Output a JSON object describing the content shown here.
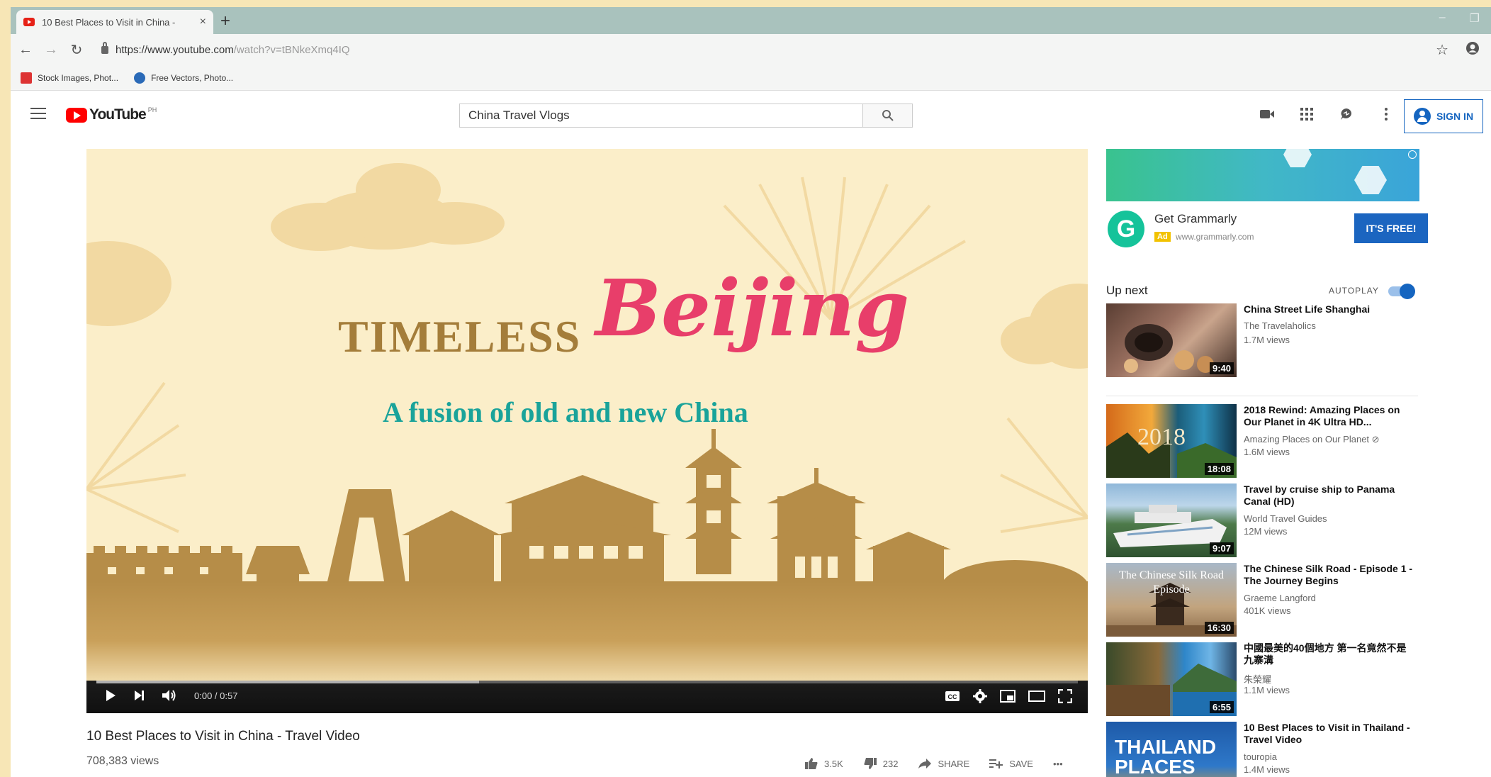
{
  "browser": {
    "tab_title": "10 Best Places to Visit in China -",
    "tab_close": "×",
    "new_tab": "+",
    "url_base": "https://www.youtube.com",
    "url_rest": "/watch?v=tBNkeXmq4IQ",
    "bookmarks": [
      "Stock Images, Phot...",
      "Free Vectors, Photo..."
    ],
    "window_controls": [
      "–",
      "❐"
    ]
  },
  "youtube": {
    "logo_text": "YouTube",
    "logo_region": "PH",
    "search_value": "China Travel Vlogs",
    "sign_in": "SIGN IN"
  },
  "player": {
    "art_title": "TIMELESS",
    "art_city": "Beijing",
    "art_subtitle": "A fusion of  old and new China",
    "time": "0:00 / 0:57",
    "progress_played": 0,
    "progress_loaded": 0.39
  },
  "video": {
    "title": "10 Best Places to Visit in China - Travel Video",
    "views": "708,383 views",
    "likes": "3.5K",
    "dislikes": "232",
    "share": "SHARE",
    "save": "SAVE",
    "more": "•••"
  },
  "ad": {
    "logo_letter": "G",
    "title": "Get Grammarly",
    "badge": "Ad",
    "url": "www.grammarly.com",
    "cta": "IT'S FREE!"
  },
  "sidebar": {
    "up_next": "Up next",
    "autoplay": "AUTOPLAY",
    "autoplay_on": true,
    "items": [
      {
        "title": "China Street Life Shanghai",
        "channel": "The Travelaholics",
        "views": "1.7M views",
        "duration": "9:40",
        "thumb_text": ""
      },
      {
        "title": "2018 Rewind: Amazing Places on Our Planet in 4K Ultra HD...",
        "channel": "Amazing Places on Our Planet ⊘",
        "views": "1.6M views",
        "duration": "18:08",
        "thumb_text": "2018"
      },
      {
        "title": "Travel by cruise ship to Panama Canal (HD)",
        "channel": "World Travel Guides",
        "views": "12M views",
        "duration": "9:07",
        "thumb_text": ""
      },
      {
        "title": "The Chinese Silk Road - Episode 1 - The Journey Begins",
        "channel": "Graeme Langford",
        "views": "401K views",
        "duration": "16:30",
        "thumb_text": "The Chinese Silk Road Episode"
      },
      {
        "title": "中國最美的40個地方 第一名竟然不是九寨溝",
        "channel": "朱榮耀",
        "views": "1.1M views",
        "duration": "6:55",
        "thumb_text": ""
      },
      {
        "title": "10 Best Places to Visit in Thailand - Travel Video",
        "channel": "touropia",
        "views": "1.4M views",
        "duration": "",
        "thumb_text": "THAILAND PLACES"
      }
    ]
  }
}
